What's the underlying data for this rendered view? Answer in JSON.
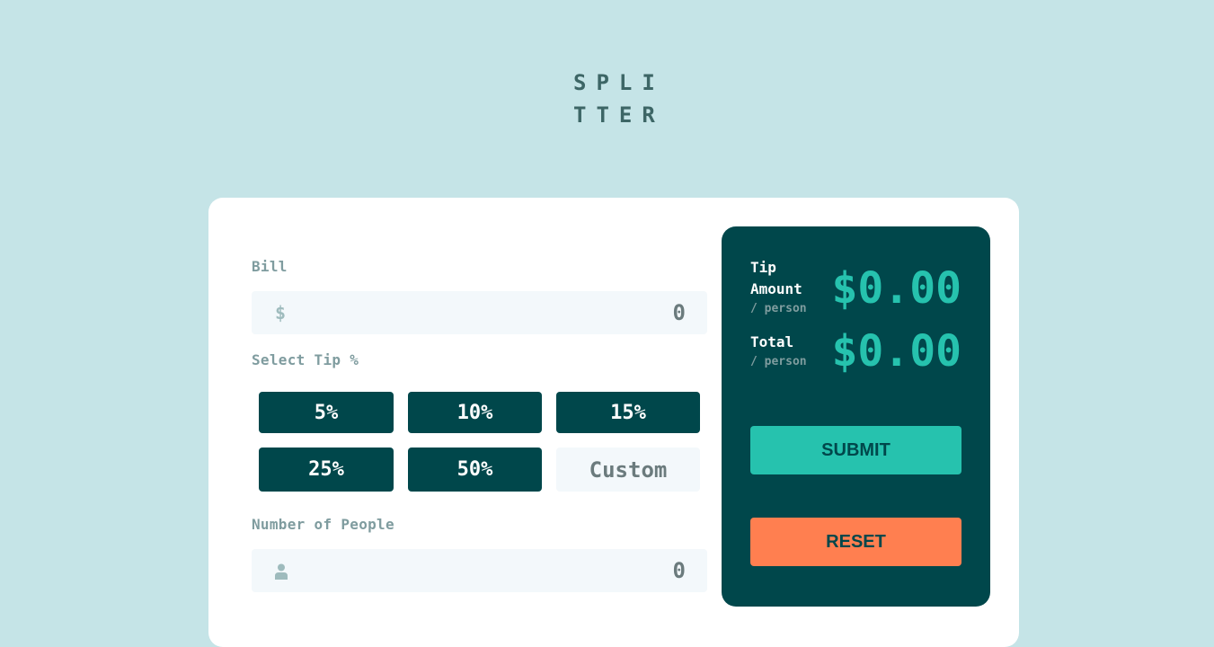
{
  "logo": {
    "line1": "SPLI",
    "line2": "TTER"
  },
  "bill": {
    "label": "Bill",
    "currency_icon": "dollar-icon",
    "currency_symbol": "$",
    "value": "0"
  },
  "tip": {
    "label": "Select Tip %",
    "options": [
      "5%",
      "10%",
      "15%",
      "25%",
      "50%"
    ],
    "custom_placeholder": "Custom"
  },
  "people": {
    "label": "Number of People",
    "icon": "person-icon",
    "value": "0"
  },
  "result": {
    "tip_label_line1": "Tip",
    "tip_label_line2": "Amount",
    "tip_sub": "/ person",
    "tip_amount": "$0.00",
    "total_label": "Total",
    "total_sub": "/ person",
    "total_amount": "$0.00"
  },
  "actions": {
    "submit_label": "SUBMIT",
    "reset_label": "RESET"
  },
  "colors": {
    "background": "#c5e4e7",
    "dark_cyan": "#00474b",
    "accent_cyan": "#26c2ae",
    "reset_orange": "#ff7f50",
    "input_bg": "#f3f8fb"
  }
}
